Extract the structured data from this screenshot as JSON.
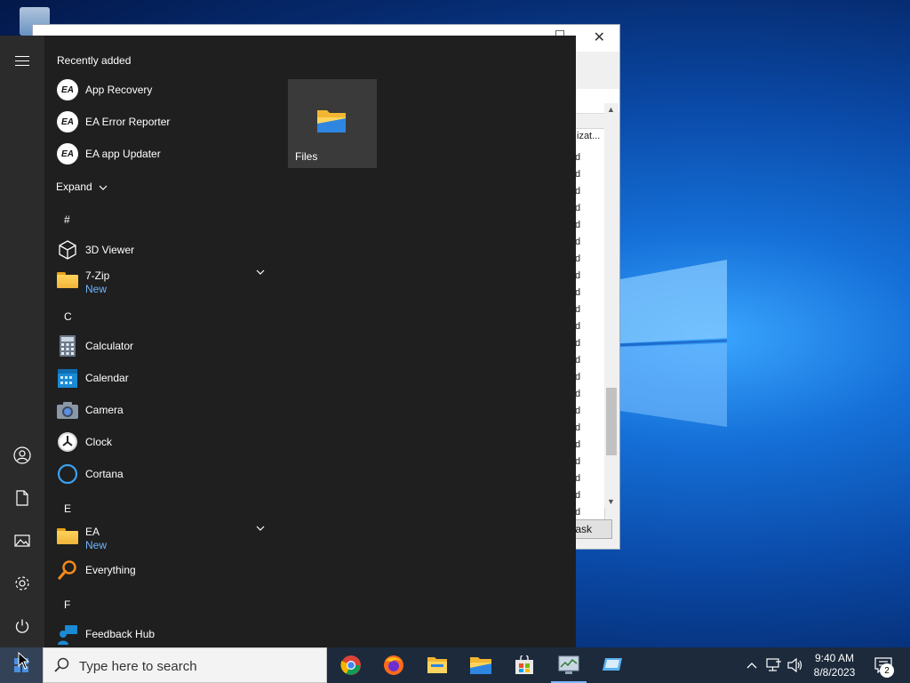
{
  "start_menu": {
    "recently_added_label": "Recently added",
    "expand_label": "Expand",
    "recent_apps": [
      {
        "label": "App Recovery",
        "icon": "ea-icon"
      },
      {
        "label": "EA Error Reporter",
        "icon": "ea-icon"
      },
      {
        "label": "EA app Updater",
        "icon": "ea-icon"
      }
    ],
    "letters": {
      "hash": "#",
      "c": "C",
      "e": "E",
      "f": "F"
    },
    "apps": {
      "viewer": {
        "label": "3D Viewer",
        "icon": "cube-icon"
      },
      "zip": {
        "label": "7-Zip",
        "sub": "New",
        "icon": "folder-icon"
      },
      "calculator": {
        "label": "Calculator",
        "icon": "calculator-icon"
      },
      "calendar": {
        "label": "Calendar",
        "icon": "calendar-icon"
      },
      "camera": {
        "label": "Camera",
        "icon": "camera-icon"
      },
      "clock": {
        "label": "Clock",
        "icon": "clock-icon"
      },
      "cortana": {
        "label": "Cortana",
        "icon": "cortana-icon"
      },
      "ea": {
        "label": "EA",
        "sub": "New",
        "icon": "folder-icon"
      },
      "everything": {
        "label": "Everything",
        "icon": "magnifier-icon"
      },
      "feedback": {
        "label": "Feedback Hub",
        "icon": "feedback-icon"
      }
    },
    "tiles": [
      {
        "label": "Files",
        "icon": "folder-icon"
      }
    ],
    "rail": [
      "menu-icon",
      "user-icon",
      "document-icon",
      "pictures-icon",
      "settings-icon",
      "power-icon"
    ]
  },
  "background_window": {
    "column_header": "izat...",
    "visible_char": "d",
    "button_label": "task"
  },
  "taskbar": {
    "search_placeholder": "Type here to search",
    "apps": [
      "chrome-icon",
      "firefox-icon",
      "file-explorer-icon",
      "files-app-icon",
      "store-icon",
      "task-manager-icon",
      "remote-desktop-icon"
    ],
    "time": "9:40 AM",
    "date": "8/8/2023",
    "notification_count": "2"
  },
  "colors": {
    "accent_new": "#6fb5ff",
    "start_bg": "#1f1f1f",
    "taskbar_bg": "#1c2a3c"
  }
}
